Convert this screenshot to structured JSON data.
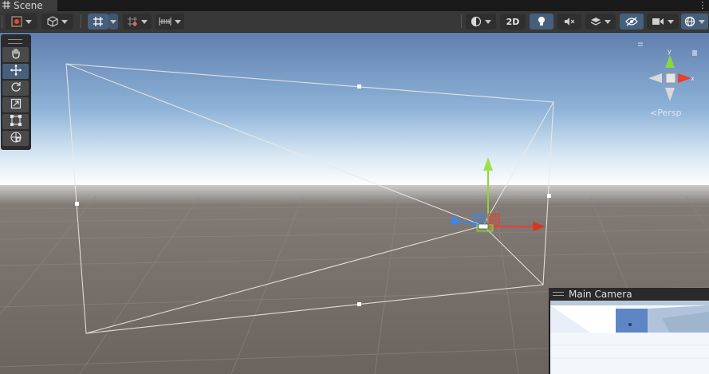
{
  "window": {
    "tab_title": "Scene",
    "tab_icon": "grid-hash-icon",
    "tab_menu_icon": "vertical-dots-icon"
  },
  "toolbar": {
    "items": [
      {
        "name": "draw-mode-dropdown",
        "icon": "shaded-sphere-icon"
      },
      {
        "name": "render-mode-dropdown",
        "icon": "cube-icon"
      },
      {
        "name": "grid-snapping-toggle",
        "icon": "grid-snap-icon",
        "active": true
      },
      {
        "name": "increment-snap-dropdown",
        "icon": "grid-increment-icon"
      },
      {
        "name": "ruler-dropdown",
        "icon": "ruler-icon"
      },
      {
        "name": "shading-mode-dropdown",
        "icon": "half-sphere-icon"
      },
      {
        "name": "2d-toggle",
        "label": "2D"
      },
      {
        "name": "lighting-toggle",
        "icon": "lightbulb-icon",
        "active": true
      },
      {
        "name": "audio-toggle",
        "icon": "speaker-mute-icon"
      },
      {
        "name": "effects-dropdown",
        "icon": "layers-effects-icon"
      },
      {
        "name": "hidden-objects-toggle",
        "icon": "eye-slash-icon",
        "active": true
      },
      {
        "name": "camera-settings-dropdown",
        "icon": "video-camera-icon"
      },
      {
        "name": "gizmos-dropdown",
        "icon": "gizmo-globe-icon",
        "active": true
      }
    ],
    "two_d_label": "2D"
  },
  "tools": [
    {
      "name": "hand-tool",
      "icon": "hand-icon",
      "active": false
    },
    {
      "name": "move-tool",
      "icon": "move-arrows-icon",
      "active": true
    },
    {
      "name": "rotate-tool",
      "icon": "rotate-icon",
      "active": false
    },
    {
      "name": "scale-tool",
      "icon": "scale-icon",
      "active": false
    },
    {
      "name": "rect-tool",
      "icon": "rect-icon",
      "active": false
    },
    {
      "name": "transform-tool",
      "icon": "transform-icon",
      "active": false
    }
  ],
  "orientation_gizmo": {
    "y_label": "y",
    "x_label": "x",
    "projection_label": "Persp"
  },
  "camera_preview": {
    "title": "Main Camera"
  },
  "colors": {
    "accent_active": "#46607c",
    "axis_x": "#e8402e",
    "axis_y": "#8cd63a",
    "axis_z": "#3c87e8",
    "sky_top": "#5f7fae",
    "horizon": "#ffffff",
    "ground": "#6e6661"
  }
}
